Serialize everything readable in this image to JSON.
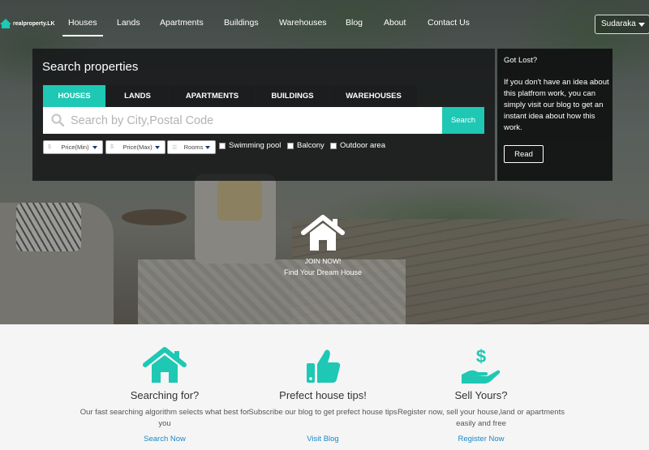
{
  "brand": {
    "logo_text": "realproperty.LK",
    "accent": "#1ec8b4"
  },
  "nav": {
    "items": [
      {
        "label": "Houses",
        "active": true
      },
      {
        "label": "Lands"
      },
      {
        "label": "Apartments"
      },
      {
        "label": "Buildings"
      },
      {
        "label": "Warehouses"
      },
      {
        "label": "Blog"
      },
      {
        "label": "About"
      },
      {
        "label": "Contact Us"
      }
    ],
    "user": "Sudaraka"
  },
  "search": {
    "title": "Search properties",
    "tabs": [
      "HOUSES",
      "LANDS",
      "APARTMENTS",
      "BUILDINGS",
      "WAREHOUSES"
    ],
    "placeholder": "Search by City,Postal Code",
    "button": "Search",
    "filters": [
      {
        "symbol": "$",
        "label": "Price(Min)"
      },
      {
        "symbol": "$",
        "label": "Price(Max)"
      },
      {
        "symbol": "☰",
        "label": "Rooms"
      }
    ],
    "checkboxes": [
      "Swimming pool",
      "Balcony",
      "Outdoor area"
    ]
  },
  "lost": {
    "title": "Got Lost?",
    "text": "If you don't have an idea about this platfrom work, you can simply visit our blog to get an instant idea about how this work.",
    "button": "Read"
  },
  "join": {
    "line1": "JOIN NOW!",
    "line2": "Find Your Dream House"
  },
  "features": [
    {
      "icon": "house-icon",
      "title": "Searching for?",
      "desc": "Our fast searching algorithm selects what best for you",
      "link": "Search Now"
    },
    {
      "icon": "thumbs-up-icon",
      "title": "Prefect house tips!",
      "desc": "Subscribe our blog to get prefect house tips",
      "link": "Visit Blog"
    },
    {
      "icon": "money-hand-icon",
      "title": "Sell Yours?",
      "desc": "Register now, sell your house,land or apartments easily and free",
      "link": "Register Now"
    }
  ]
}
